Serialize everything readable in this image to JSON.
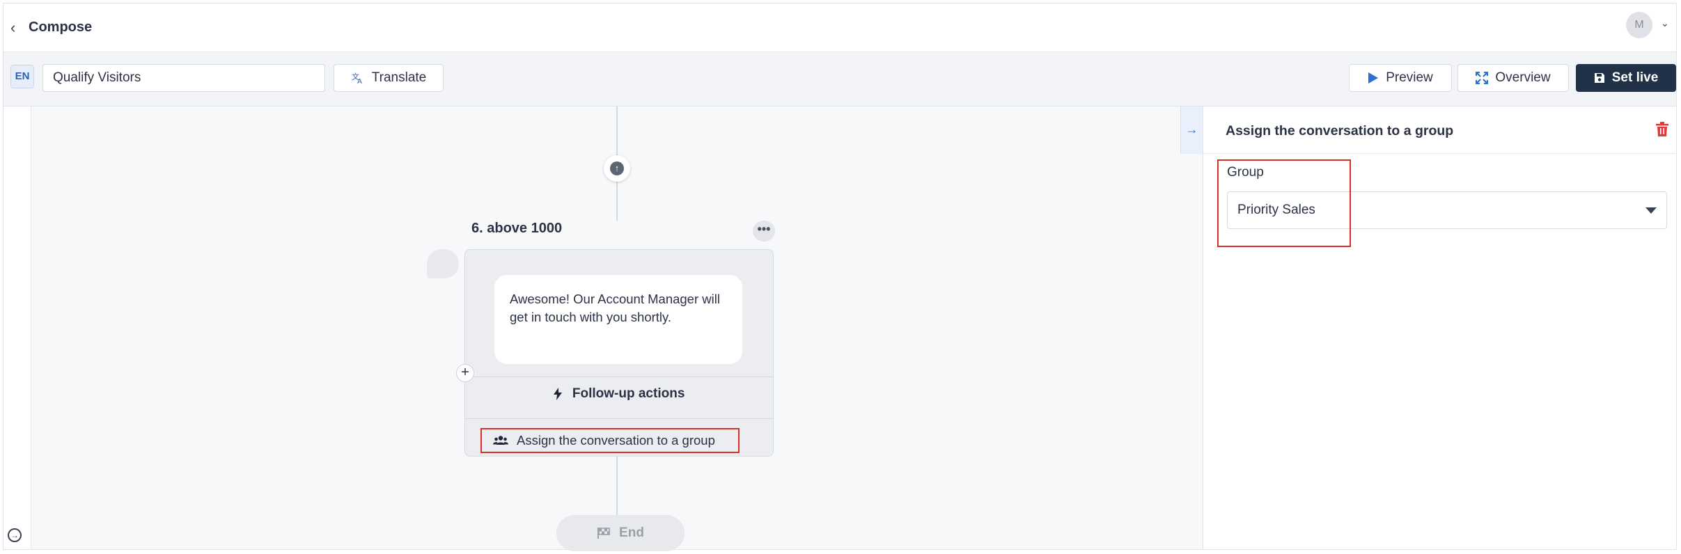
{
  "topbar": {
    "title": "Compose",
    "avatar_initial": "M"
  },
  "toolbar": {
    "language": "EN",
    "flow_name": "Qualify Visitors",
    "translate_label": "Translate",
    "preview_label": "Preview",
    "overview_label": "Overview",
    "set_live_label": "Set live"
  },
  "canvas": {
    "step": {
      "number": "6.",
      "label": "above 1000",
      "message": "Awesome! Our Account Manager will get in touch with you shortly.",
      "followup_label": "Follow-up actions",
      "action_label": "Assign the conversation to a group"
    },
    "end_label": "End"
  },
  "panel": {
    "title": "Assign the conversation to a group",
    "group_label": "Group",
    "group_value": "Priority Sales"
  },
  "colors": {
    "primary_dark": "#203148",
    "accent_blue": "#2d6fd2",
    "highlight_red": "#d93025",
    "danger": "#e03a3a"
  }
}
